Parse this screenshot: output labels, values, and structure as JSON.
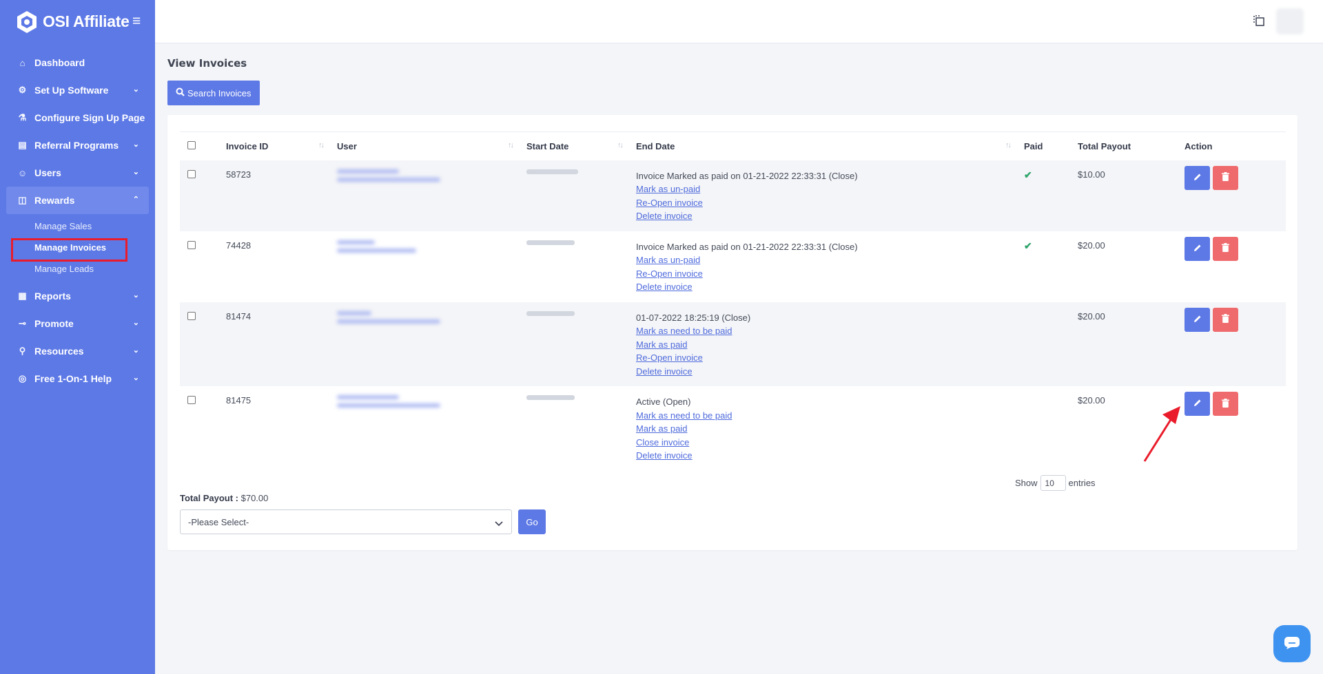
{
  "brand": {
    "name": "OSI Affiliate"
  },
  "sidebar": {
    "items": [
      {
        "label": "Dashboard",
        "icon": "home-icon",
        "has_chevron": false
      },
      {
        "label": "Set Up Software",
        "icon": "gear-icon",
        "has_chevron": true
      },
      {
        "label": "Configure Sign Up Page",
        "icon": "flask-icon",
        "has_chevron": false
      },
      {
        "label": "Referral Programs",
        "icon": "tag-icon",
        "has_chevron": true
      },
      {
        "label": "Users",
        "icon": "user-icon",
        "has_chevron": true
      },
      {
        "label": "Rewards",
        "icon": "gift-icon",
        "has_chevron": true,
        "active": true
      },
      {
        "label": "Reports",
        "icon": "chart-icon",
        "has_chevron": true
      },
      {
        "label": "Promote",
        "icon": "share-icon",
        "has_chevron": true
      },
      {
        "label": "Resources",
        "icon": "network-icon",
        "has_chevron": true
      },
      {
        "label": "Free 1-On-1 Help",
        "icon": "lifebuoy-icon",
        "has_chevron": true
      }
    ],
    "rewards_sub": [
      {
        "label": "Manage Sales"
      },
      {
        "label": "Manage Invoices",
        "current": true
      },
      {
        "label": "Manage Leads"
      }
    ]
  },
  "page": {
    "title": "View Invoices",
    "search_button": "Search Invoices"
  },
  "table": {
    "columns": [
      "Invoice ID",
      "User",
      "Start Date",
      "End Date",
      "Paid",
      "Total Payout",
      "Action"
    ],
    "rows": [
      {
        "invoice_id": "58723",
        "end_status": "Invoice Marked as paid on 01-21-2022 22:33:31 (Close)",
        "links": [
          "Mark as un-paid",
          "Re-Open invoice",
          "Delete invoice"
        ],
        "paid": true,
        "total_payout": "$10.00"
      },
      {
        "invoice_id": "74428",
        "end_status": "Invoice Marked as paid on 01-21-2022 22:33:31 (Close)",
        "links": [
          "Mark as un-paid",
          "Re-Open invoice",
          "Delete invoice"
        ],
        "paid": true,
        "total_payout": "$20.00"
      },
      {
        "invoice_id": "81474",
        "end_status": "01-07-2022 18:25:19 (Close)",
        "links": [
          "Mark as need to be paid",
          "Mark as paid",
          "Re-Open invoice",
          "Delete invoice"
        ],
        "paid": false,
        "total_payout": "$20.00"
      },
      {
        "invoice_id": "81475",
        "end_status": "Active (Open)",
        "links": [
          "Mark as need to be paid",
          "Mark as paid",
          "Close invoice",
          "Delete invoice"
        ],
        "paid": false,
        "total_payout": "$20.00"
      }
    ]
  },
  "footer": {
    "show_label": "Show",
    "entries_value": "10",
    "entries_label": "entries",
    "total_payout_label": "Total Payout :",
    "total_payout_value": "$70.00",
    "select_value": "-Please Select-",
    "go_label": "Go"
  },
  "colors": {
    "sidebar": "#5d79e6",
    "primary": "#5d79e6",
    "danger": "#ef6a6d",
    "success": "#2ea56b",
    "highlight_box": "#ea1c2b"
  }
}
